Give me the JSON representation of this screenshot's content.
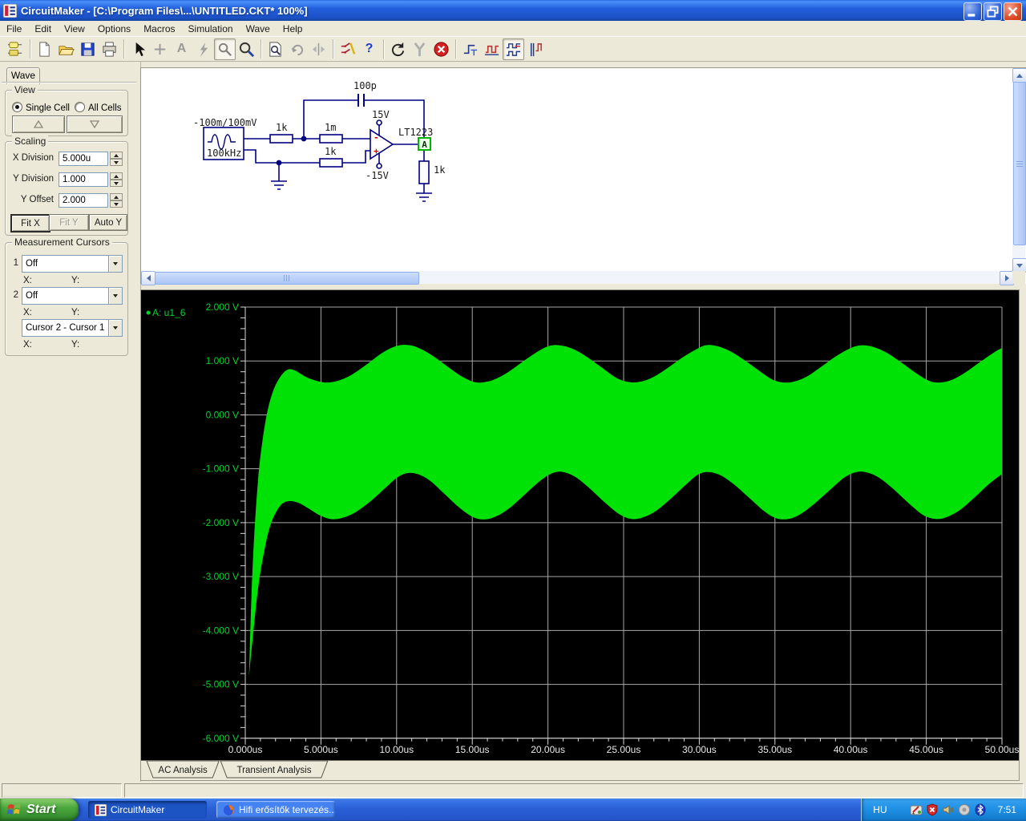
{
  "window": {
    "title": "CircuitMaker - [C:\\Program Files\\...\\UNTITLED.CKT* 100%]"
  },
  "menu": {
    "items": [
      "File",
      "Edit",
      "View",
      "Options",
      "Macros",
      "Simulation",
      "Wave",
      "Help"
    ]
  },
  "toolbar": {
    "buttons": [
      {
        "name": "parts-browser-button",
        "icon": "parts-browser",
        "state": "normal"
      },
      {
        "sep": true
      },
      {
        "name": "new-file-button",
        "icon": "new-file",
        "state": "normal"
      },
      {
        "name": "open-file-button",
        "icon": "open-file",
        "state": "normal"
      },
      {
        "name": "save-file-button",
        "icon": "save-file",
        "state": "normal"
      },
      {
        "name": "print-button",
        "icon": "print",
        "state": "normal"
      },
      {
        "sep": true
      },
      {
        "name": "select-arrow-button",
        "icon": "select-arrow",
        "state": "normal"
      },
      {
        "name": "wire-tool-button",
        "icon": "wire-plus",
        "state": "disabled"
      },
      {
        "name": "text-tool-button",
        "icon": "glyph",
        "glyph": "A",
        "color": "#9a9a9a",
        "state": "disabled"
      },
      {
        "name": "run-probe-button",
        "icon": "lightning",
        "state": "disabled"
      },
      {
        "name": "probe-tool-button",
        "icon": "probe",
        "state": "pressed"
      },
      {
        "name": "zoom-tool-button",
        "icon": "zoom",
        "state": "normal"
      },
      {
        "sep": true
      },
      {
        "name": "search-part-button",
        "icon": "search-doc",
        "state": "normal"
      },
      {
        "name": "rotate-button",
        "icon": "rotate",
        "state": "disabled"
      },
      {
        "name": "mirror-button",
        "icon": "mirror",
        "state": "disabled"
      },
      {
        "sep": true
      },
      {
        "name": "digital-analog-switch-button",
        "icon": "switch",
        "state": "normal"
      },
      {
        "name": "help-button",
        "icon": "glyph",
        "glyph": "?",
        "color": "#1a3fd4",
        "state": "normal"
      },
      {
        "sep": true
      },
      {
        "name": "reset-button",
        "icon": "reset",
        "state": "normal"
      },
      {
        "name": "step-tool-button",
        "icon": "wishbone",
        "state": "disabled"
      },
      {
        "name": "stop-button",
        "icon": "stop",
        "state": "normal"
      },
      {
        "sep": true
      },
      {
        "name": "transient-setup-button",
        "icon": "wave-step",
        "state": "normal"
      },
      {
        "name": "analog-analysis-button",
        "icon": "wave-square",
        "state": "normal"
      },
      {
        "name": "mixed-analysis-button",
        "icon": "wave-mixed",
        "state": "pressed"
      },
      {
        "name": "digital-analysis-button",
        "icon": "wave-digital",
        "state": "normal"
      }
    ]
  },
  "sidebar": {
    "tab": "Wave",
    "view": {
      "label": "View",
      "options": [
        {
          "label": "Single Cell",
          "checked": true
        },
        {
          "label": "All Cells",
          "checked": false
        }
      ]
    },
    "scaling": {
      "label": "Scaling",
      "fields": [
        {
          "label": "X Division",
          "value": "5.000u"
        },
        {
          "label": "Y Division",
          "value": "1.000"
        },
        {
          "label": "Y Offset",
          "value": "2.000"
        }
      ],
      "buttons": [
        {
          "label": "Fit X",
          "state": "default"
        },
        {
          "label": "Fit Y",
          "state": "disabled"
        },
        {
          "label": "Auto Y",
          "state": "normal"
        }
      ]
    },
    "cursors": {
      "label": "Measurement Cursors",
      "x_label": "X:",
      "y_label": "Y:",
      "cursor1": {
        "index": "1",
        "value": "Off"
      },
      "cursor2": {
        "index": "2",
        "value": "Off"
      },
      "diff": {
        "value": "Cursor 2 - Cursor 1"
      }
    }
  },
  "schematic": {
    "labels": {
      "source_range": "-100m/100mV",
      "source_freq": "100kHz",
      "r_in": "1k",
      "r_feed": "1m",
      "r_plus": "1k",
      "r_load": "1k",
      "cap": "100p",
      "v_plus": "15V",
      "v_minus": "-15V",
      "opamp_minus": "-",
      "opamp_plus": "+",
      "opamp": "LT1223",
      "probe": "A"
    }
  },
  "chart_data": {
    "type": "area",
    "title": "Transient Analysis",
    "trace": "A: u1_6",
    "legend_position": "top-left",
    "grid": true,
    "xlim": [
      0,
      50
    ],
    "ylim": [
      -6,
      2
    ],
    "x_unit": "us",
    "y_unit": "V",
    "x_ticks": [
      "0.000us",
      "5.000us",
      "10.00us",
      "15.00us",
      "20.00us",
      "25.00us",
      "30.00us",
      "35.00us",
      "40.00us",
      "45.00us",
      "50.00us"
    ],
    "x_tick_values": [
      0,
      5,
      10,
      15,
      20,
      25,
      30,
      35,
      40,
      45,
      50
    ],
    "y_ticks": [
      "2.000 V",
      "1.000 V",
      "0.000 V",
      "-1.000 V",
      "-2.000 V",
      "-3.000 V",
      "-4.000 V",
      "-5.000 V",
      "-6.000 V"
    ],
    "y_tick_values": [
      2,
      1,
      0,
      -1,
      -2,
      -3,
      -4,
      -5,
      -6
    ],
    "description": "High-frequency oscillation band: area filled between upper and lower envelopes; startup transient dips to -4.85 V then settles into ~0.1 MHz amplitude-modulated band.",
    "series": [
      {
        "name": "upper_envelope",
        "points": [
          [
            0.25,
            -4.85
          ],
          [
            0.4,
            -3.4
          ],
          [
            0.6,
            -2.2
          ],
          [
            0.85,
            -1.2
          ],
          [
            1.1,
            -0.55
          ],
          [
            1.45,
            0.05
          ],
          [
            1.85,
            0.45
          ],
          [
            2.3,
            0.7
          ],
          [
            2.8,
            0.84
          ],
          [
            3.3,
            0.82
          ],
          [
            3.9,
            0.72
          ],
          [
            4.6,
            0.64
          ],
          [
            5.3,
            0.6
          ],
          [
            6.1,
            0.63
          ],
          [
            7.0,
            0.74
          ],
          [
            8.0,
            0.93
          ],
          [
            9.0,
            1.14
          ],
          [
            9.8,
            1.26
          ],
          [
            10.5,
            1.3
          ],
          [
            11.3,
            1.26
          ],
          [
            12.2,
            1.13
          ],
          [
            13.2,
            0.93
          ],
          [
            14.2,
            0.73
          ],
          [
            15.0,
            0.62
          ],
          [
            15.6,
            0.6
          ],
          [
            16.4,
            0.65
          ],
          [
            17.3,
            0.78
          ],
          [
            18.3,
            0.98
          ],
          [
            19.3,
            1.17
          ],
          [
            20.1,
            1.28
          ],
          [
            20.8,
            1.29
          ],
          [
            21.6,
            1.23
          ],
          [
            22.5,
            1.09
          ],
          [
            23.5,
            0.89
          ],
          [
            24.5,
            0.69
          ],
          [
            25.3,
            0.61
          ],
          [
            26.0,
            0.61
          ],
          [
            26.8,
            0.68
          ],
          [
            27.7,
            0.83
          ],
          [
            28.7,
            1.03
          ],
          [
            29.7,
            1.2
          ],
          [
            30.4,
            1.29
          ],
          [
            31.1,
            1.28
          ],
          [
            31.9,
            1.2
          ],
          [
            32.8,
            1.05
          ],
          [
            33.8,
            0.85
          ],
          [
            34.8,
            0.66
          ],
          [
            35.6,
            0.6
          ],
          [
            36.3,
            0.62
          ],
          [
            37.1,
            0.71
          ],
          [
            38.0,
            0.88
          ],
          [
            39.0,
            1.08
          ],
          [
            40.0,
            1.24
          ],
          [
            40.7,
            1.29
          ],
          [
            41.5,
            1.26
          ],
          [
            42.4,
            1.15
          ],
          [
            43.4,
            0.96
          ],
          [
            44.4,
            0.76
          ],
          [
            45.2,
            0.63
          ],
          [
            45.9,
            0.6
          ],
          [
            46.7,
            0.65
          ],
          [
            47.6,
            0.79
          ],
          [
            48.6,
            0.99
          ],
          [
            49.6,
            1.18
          ],
          [
            50,
            1.24
          ]
        ]
      },
      {
        "name": "lower_envelope",
        "points": [
          [
            0.25,
            -4.85
          ],
          [
            0.45,
            -4.25
          ],
          [
            0.65,
            -3.7
          ],
          [
            0.9,
            -3.1
          ],
          [
            1.2,
            -2.6
          ],
          [
            1.55,
            -2.15
          ],
          [
            1.95,
            -1.85
          ],
          [
            2.4,
            -1.66
          ],
          [
            2.9,
            -1.6
          ],
          [
            3.5,
            -1.63
          ],
          [
            4.2,
            -1.74
          ],
          [
            4.9,
            -1.86
          ],
          [
            5.6,
            -1.93
          ],
          [
            6.3,
            -1.92
          ],
          [
            7.2,
            -1.82
          ],
          [
            8.2,
            -1.62
          ],
          [
            9.2,
            -1.37
          ],
          [
            10.0,
            -1.17
          ],
          [
            10.7,
            -1.08
          ],
          [
            11.4,
            -1.1
          ],
          [
            12.2,
            -1.22
          ],
          [
            13.1,
            -1.45
          ],
          [
            14.1,
            -1.71
          ],
          [
            15.0,
            -1.89
          ],
          [
            15.8,
            -1.94
          ],
          [
            16.6,
            -1.88
          ],
          [
            17.5,
            -1.72
          ],
          [
            18.5,
            -1.47
          ],
          [
            19.5,
            -1.22
          ],
          [
            20.3,
            -1.08
          ],
          [
            21.0,
            -1.06
          ],
          [
            21.8,
            -1.15
          ],
          [
            22.7,
            -1.35
          ],
          [
            23.7,
            -1.61
          ],
          [
            24.7,
            -1.84
          ],
          [
            25.5,
            -1.93
          ],
          [
            26.2,
            -1.91
          ],
          [
            27.1,
            -1.79
          ],
          [
            28.1,
            -1.56
          ],
          [
            29.1,
            -1.3
          ],
          [
            29.9,
            -1.11
          ],
          [
            30.6,
            -1.06
          ],
          [
            31.4,
            -1.12
          ],
          [
            32.3,
            -1.29
          ],
          [
            33.3,
            -1.54
          ],
          [
            34.3,
            -1.79
          ],
          [
            35.1,
            -1.92
          ],
          [
            35.9,
            -1.93
          ],
          [
            36.7,
            -1.84
          ],
          [
            37.6,
            -1.65
          ],
          [
            38.6,
            -1.4
          ],
          [
            39.6,
            -1.16
          ],
          [
            40.4,
            -1.06
          ],
          [
            41.1,
            -1.07
          ],
          [
            41.9,
            -1.17
          ],
          [
            42.8,
            -1.37
          ],
          [
            43.8,
            -1.63
          ],
          [
            44.8,
            -1.86
          ],
          [
            45.6,
            -1.93
          ],
          [
            46.3,
            -1.9
          ],
          [
            47.2,
            -1.77
          ],
          [
            48.2,
            -1.53
          ],
          [
            49.2,
            -1.27
          ],
          [
            50,
            -1.1
          ]
        ]
      }
    ],
    "colors": {
      "trace": "#00e206",
      "grid": "#a8a8a8",
      "axis": "#d8d8d8",
      "y_label": "#00d22d",
      "x_label": "#e8e8e8",
      "background": "#000000"
    }
  },
  "analysis_tabs": [
    {
      "label": "AC Analysis"
    },
    {
      "label": "Transient Analysis"
    }
  ],
  "taskbar": {
    "start_label": "Start",
    "tasks": [
      {
        "label": "CircuitMaker",
        "icon": "circuitmaker-icon",
        "active": true
      },
      {
        "label": "Hifi erősítők tervezés...",
        "icon": "firefox-icon",
        "active": false
      }
    ],
    "tray": {
      "language": "HU",
      "icons": [
        "pen-tablet-icon",
        "security-shield-icon",
        "volume-icon",
        "audio-device-icon",
        "bluetooth-icon"
      ],
      "time": "7:51"
    }
  }
}
